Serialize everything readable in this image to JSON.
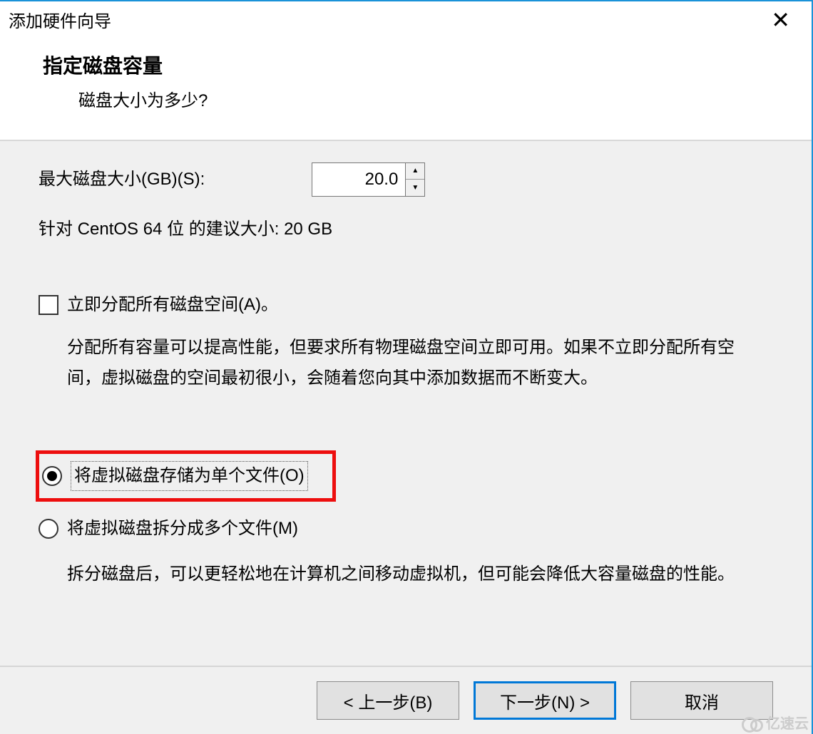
{
  "window": {
    "title": "添加硬件向导"
  },
  "header": {
    "title": "指定磁盘容量",
    "subtitle": "磁盘大小为多少?"
  },
  "diskSize": {
    "label": "最大磁盘大小(GB)(S):",
    "value": "20.0",
    "recommend": "针对 CentOS 64 位 的建议大小: 20 GB"
  },
  "allocate": {
    "label": "立即分配所有磁盘空间(A)。",
    "desc": "分配所有容量可以提高性能，但要求所有物理磁盘空间立即可用。如果不立即分配所有空间，虚拟磁盘的空间最初很小，会随着您向其中添加数据而不断变大。"
  },
  "storeSingle": {
    "label": "将虚拟磁盘存储为单个文件(O)"
  },
  "storeSplit": {
    "label": "将虚拟磁盘拆分成多个文件(M)",
    "desc": "拆分磁盘后，可以更轻松地在计算机之间移动虚拟机，但可能会降低大容量磁盘的性能。"
  },
  "footer": {
    "back": "< 上一步(B)",
    "next": "下一步(N) >",
    "cancel": "取消"
  },
  "watermark": "亿速云"
}
